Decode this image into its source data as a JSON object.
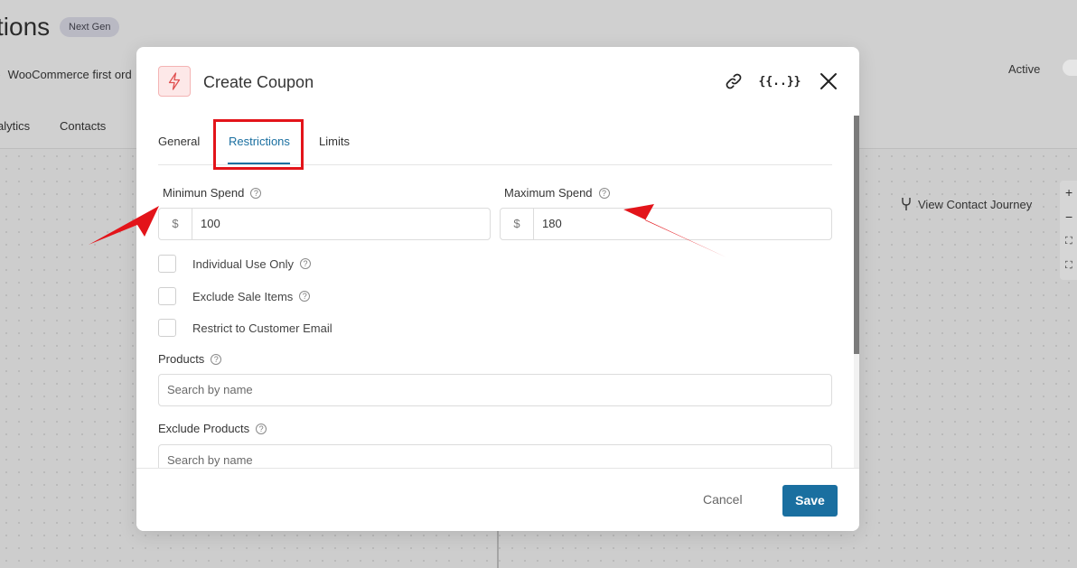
{
  "background": {
    "title": "tions",
    "badge": "Next Gen",
    "breadcrumb": "WooCommerce first ord",
    "tabs": [
      "alytics",
      "Contacts"
    ],
    "status": "Active",
    "journey_link": "View Contact Journey",
    "zoom": [
      "+",
      "−",
      "⛶",
      "⛶"
    ]
  },
  "modal": {
    "title": "Create Coupon",
    "tabs": [
      {
        "label": "General"
      },
      {
        "label": "Restrictions"
      },
      {
        "label": "Limits"
      }
    ],
    "active_tab": "Restrictions",
    "min_spend": {
      "label": "Minimun Spend",
      "prefix": "$",
      "value": "100"
    },
    "max_spend": {
      "label": "Maximum Spend",
      "prefix": "$",
      "value": "180"
    },
    "checkboxes": [
      {
        "label": "Individual Use Only",
        "checked": false,
        "help": true
      },
      {
        "label": "Exclude Sale Items",
        "checked": false,
        "help": true
      },
      {
        "label": "Restrict to Customer Email",
        "checked": false,
        "help": false
      }
    ],
    "products": {
      "label": "Products",
      "placeholder": "Search by name"
    },
    "exclude_products": {
      "label": "Exclude Products",
      "placeholder": "Search by name"
    },
    "help_glyph": "?",
    "footer": {
      "cancel_label": "Cancel",
      "save_label": "Save"
    }
  },
  "colors": {
    "accent": "#1a6fa0",
    "annotation": "#e3141a",
    "icon_bg": "#fde8e8"
  }
}
